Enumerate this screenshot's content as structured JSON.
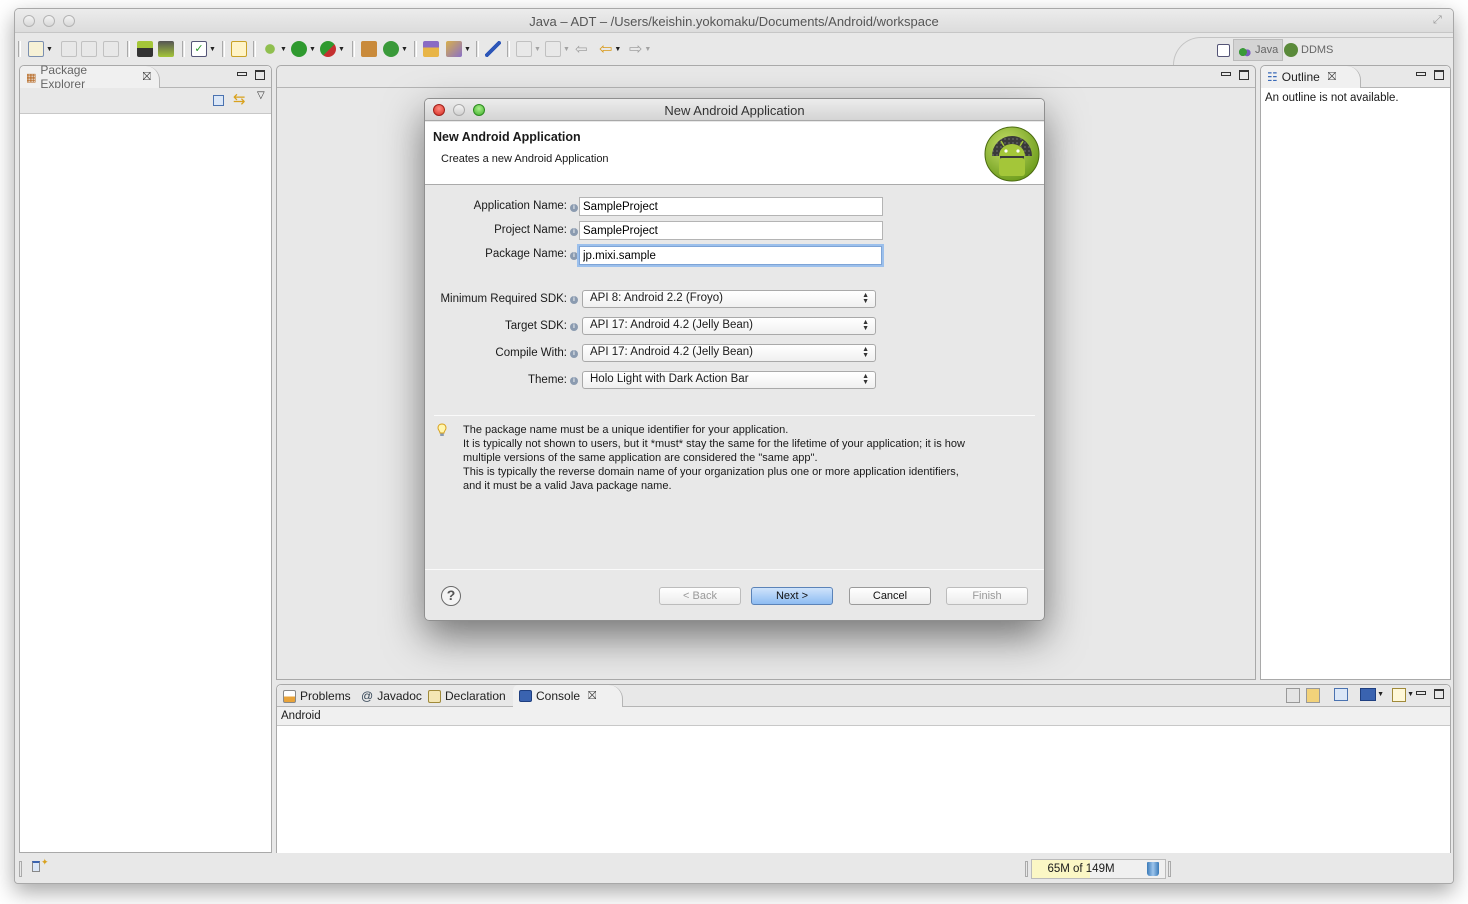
{
  "window": {
    "title": "Java – ADT – /Users/keishin.yokomaku/Documents/Android/workspace"
  },
  "toolbar": {
    "icons": [
      "new-wizard-icon",
      "save-icon",
      "save-all-icon",
      "print-icon",
      "android-sdk-manager-icon",
      "android-avd-manager-icon",
      "task-icon",
      "new-android-xml-icon",
      "debug-icon",
      "run-icon",
      "external-tools-icon",
      "new-java-package-icon",
      "new-java-class-icon",
      "open-type-icon",
      "search-icon",
      "skip-breakpoints-icon",
      "next-annotation-icon",
      "previous-annotation-icon",
      "last-edit-location-icon",
      "back-icon",
      "forward-icon"
    ]
  },
  "perspectives": {
    "items": [
      {
        "label": "Java",
        "active": true
      },
      {
        "label": "DDMS",
        "active": false
      }
    ]
  },
  "package_explorer": {
    "tab_label": "Package Explorer"
  },
  "outline": {
    "tab_label": "Outline",
    "message": "An outline is not available."
  },
  "bottom_panel": {
    "tabs": [
      {
        "label": "Problems"
      },
      {
        "label": "Javadoc"
      },
      {
        "label": "Declaration"
      },
      {
        "label": "Console",
        "selected": true
      }
    ],
    "console_header": "Android"
  },
  "dialog": {
    "window_title": "New Android Application",
    "header_title": "New Android Application",
    "header_description": "Creates a new Android Application",
    "fields": {
      "application_name": {
        "label": "Application Name:",
        "value": "SampleProject"
      },
      "project_name": {
        "label": "Project Name:",
        "value": "SampleProject"
      },
      "package_name": {
        "label": "Package Name:",
        "value": "jp.mixi.sample"
      }
    },
    "selects": {
      "min_sdk": {
        "label": "Minimum Required SDK:",
        "value": "API 8: Android 2.2 (Froyo)"
      },
      "target_sdk": {
        "label": "Target SDK:",
        "value": "API 17: Android 4.2 (Jelly Bean)"
      },
      "compile_with": {
        "label": "Compile With:",
        "value": "API 17: Android 4.2 (Jelly Bean)"
      },
      "theme": {
        "label": "Theme:",
        "value": "Holo Light with Dark Action Bar"
      }
    },
    "tip_lines": [
      "The package name must be a unique identifier for your application.",
      "It is typically not shown to users, but it *must* stay the same for the lifetime of your application; it is how",
      "multiple versions of the same application are considered the \"same app\".",
      "This is typically the reverse domain name of your organization plus one or more application identifiers,",
      "and it must be a valid Java package name."
    ],
    "buttons": {
      "help": "?",
      "back": "< Back",
      "next": "Next >",
      "cancel": "Cancel",
      "finish": "Finish"
    }
  },
  "status": {
    "heap_used": "65M",
    "heap_total": "149M",
    "heap_text": "65M of 149M",
    "heap_used_fraction": 0.436
  },
  "colors": {
    "accent_blue": "#8ebcf2",
    "android_green": "#a4c639",
    "heap_fill": "#fbf7c5"
  }
}
